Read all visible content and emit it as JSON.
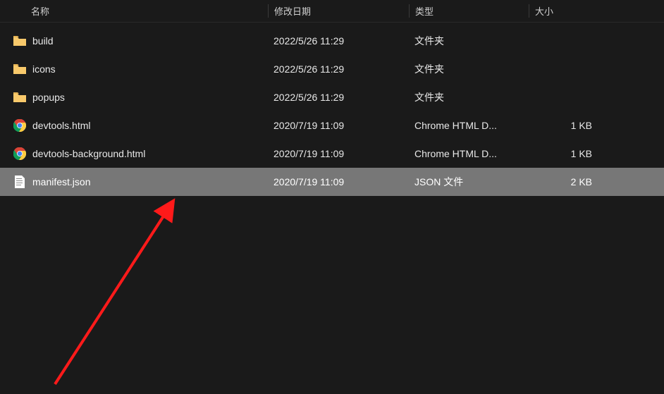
{
  "columns": {
    "name": "名称",
    "date": "修改日期",
    "type": "类型",
    "size": "大小"
  },
  "rows": [
    {
      "icon": "folder",
      "name": "build",
      "date": "2022/5/26 11:29",
      "type": "文件夹",
      "size": "",
      "selected": false
    },
    {
      "icon": "folder",
      "name": "icons",
      "date": "2022/5/26 11:29",
      "type": "文件夹",
      "size": "",
      "selected": false
    },
    {
      "icon": "folder",
      "name": "popups",
      "date": "2022/5/26 11:29",
      "type": "文件夹",
      "size": "",
      "selected": false
    },
    {
      "icon": "chrome",
      "name": "devtools.html",
      "date": "2020/7/19 11:09",
      "type": "Chrome HTML D...",
      "size": "1 KB",
      "selected": false
    },
    {
      "icon": "chrome",
      "name": "devtools-background.html",
      "date": "2020/7/19 11:09",
      "type": "Chrome HTML D...",
      "size": "1 KB",
      "selected": false
    },
    {
      "icon": "file",
      "name": "manifest.json",
      "date": "2020/7/19 11:09",
      "type": "JSON 文件",
      "size": "2 KB",
      "selected": true
    }
  ]
}
